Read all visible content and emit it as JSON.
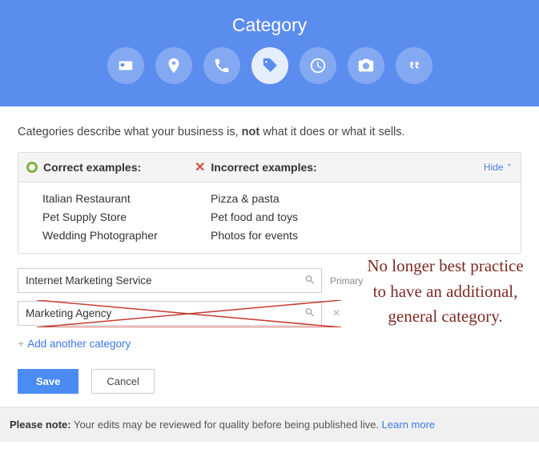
{
  "header": {
    "title": "Category"
  },
  "description": {
    "pre": "Categories describe what your business is, ",
    "bold": "not",
    "post": " what it does or what it sells."
  },
  "examples": {
    "correct_heading": "Correct examples:",
    "incorrect_heading": "Incorrect examples:",
    "hide": "Hide",
    "correct": [
      "Italian Restaurant",
      "Pet Supply Store",
      "Wedding Photographer"
    ],
    "incorrect": [
      "Pizza & pasta",
      "Pet food and toys",
      "Photos for events"
    ]
  },
  "categories": {
    "primary_value": "Internet Marketing Service",
    "primary_label": "Primary",
    "secondary_value": "Marketing Agency",
    "add_link": "Add another category"
  },
  "annotation": "No longer best practice to have an additional, general category.",
  "buttons": {
    "save": "Save",
    "cancel": "Cancel"
  },
  "footer": {
    "note_label": "Please note:",
    "note_text": " Your edits may be reviewed for quality before being published live. ",
    "learn_more": "Learn more"
  }
}
